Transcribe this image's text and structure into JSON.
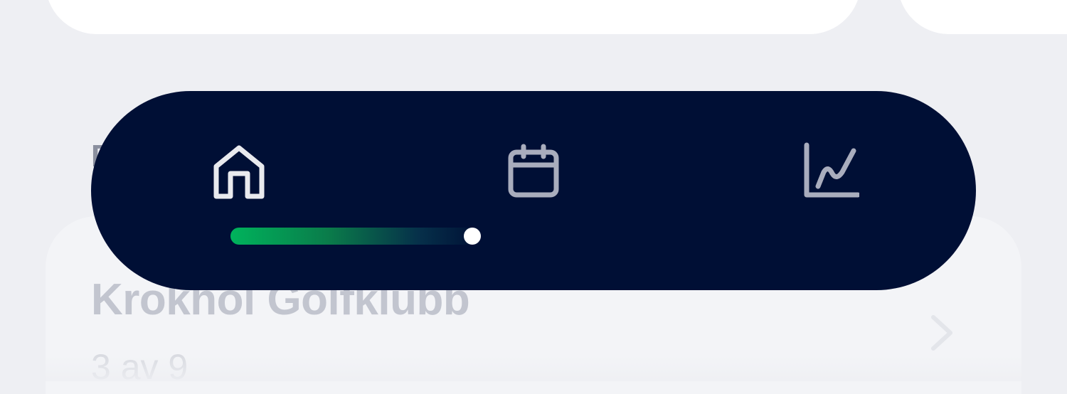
{
  "background": {
    "section_letter": "D",
    "club_card": {
      "name": "Krokhol Golfklubb",
      "subtitle": "3 av 9",
      "chevron_icon": "chevron-right-icon"
    }
  },
  "navbar": {
    "items": [
      {
        "name": "home",
        "icon": "home-icon",
        "active": true
      },
      {
        "name": "calendar",
        "icon": "calendar-icon",
        "active": false
      },
      {
        "name": "stats",
        "icon": "chart-icon",
        "active": false
      }
    ],
    "progress": 1.0,
    "colors": {
      "bar_background": "#000f35",
      "active_icon": "#e9eaee",
      "inactive_icon": "#a9adbd",
      "progress_start": "#00b35c",
      "progress_dot": "#ffffff"
    }
  }
}
